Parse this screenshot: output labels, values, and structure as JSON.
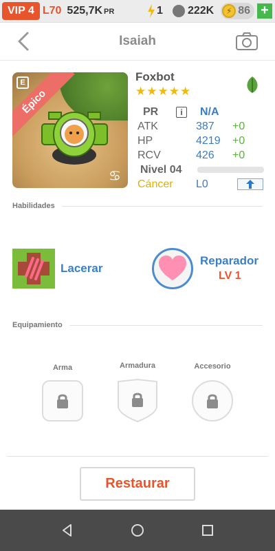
{
  "status": {
    "vip": "VIP 4",
    "level": "L70",
    "power": "525,7K",
    "power_unit": "PR",
    "energy": "1",
    "paws": "222K",
    "coins": "86",
    "plus": "+"
  },
  "header": {
    "title": "Isaiah"
  },
  "pet": {
    "name": "Foxbot",
    "rarity": "Épico",
    "stars": "★★★★★",
    "stats": {
      "pr_label": "PR",
      "pr_value": "N/A",
      "info_icon": "i",
      "atk_label": "ATK",
      "atk_value": "387",
      "atk_delta": "+0",
      "hp_label": "HP",
      "hp_value": "4219",
      "hp_delta": "+0",
      "rcv_label": "RCV",
      "rcv_value": "426",
      "rcv_delta": "+0",
      "level_label": "Nivel 04",
      "level_progress": 0,
      "sign": "Cáncer",
      "sign_level": "L0"
    }
  },
  "abilities": {
    "heading": "Habilidades",
    "items": [
      {
        "label": "Lacerar"
      },
      {
        "label": "Reparador",
        "level": "LV 1"
      }
    ]
  },
  "equipment": {
    "heading": "Equipamiento",
    "slots": [
      {
        "label": "Arma"
      },
      {
        "label": "Armadura"
      },
      {
        "label": "Accesorio"
      }
    ]
  },
  "actions": {
    "restore": "Restaurar"
  },
  "colors": {
    "accent": "#e8542c",
    "blue": "#3b7fc4",
    "green": "#5fb042",
    "gold": "#f1b90d"
  }
}
